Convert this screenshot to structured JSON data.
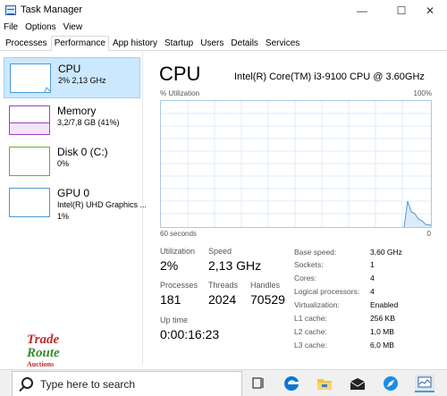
{
  "window": {
    "title": "Task Manager"
  },
  "menu": [
    "File",
    "Options",
    "View"
  ],
  "tabs": [
    "Processes",
    "Performance",
    "App history",
    "Startup",
    "Users",
    "Details",
    "Services"
  ],
  "sidebar": {
    "items": [
      {
        "name": "CPU",
        "detail": "2% 2,13 GHz",
        "detail2": ""
      },
      {
        "name": "Memory",
        "detail": "3,2/7,8 GB (41%)",
        "detail2": ""
      },
      {
        "name": "Disk 0 (C:)",
        "detail": "0%",
        "detail2": ""
      },
      {
        "name": "GPU 0",
        "detail": "Intel(R) UHD Graphics ...",
        "detail2": "1%"
      }
    ]
  },
  "main": {
    "title": "CPU",
    "model": "Intel(R) Core(TM) i3-9100 CPU @ 3.60GHz",
    "util_label": "% Utilization",
    "util_max": "100%",
    "axis_left": "60 seconds",
    "axis_right": "0",
    "stats": {
      "utilization": {
        "label": "Utilization",
        "value": "2%"
      },
      "speed": {
        "label": "Speed",
        "value": "2,13 GHz"
      },
      "processes": {
        "label": "Processes",
        "value": "181"
      },
      "threads": {
        "label": "Threads",
        "value": "2024"
      },
      "handles": {
        "label": "Handles",
        "value": "70529"
      },
      "uptime": {
        "label": "Up time",
        "value": "0:00:16:23"
      }
    },
    "specs": [
      {
        "label": "Base speed:",
        "value": "3,60 GHz"
      },
      {
        "label": "Sockets:",
        "value": "1"
      },
      {
        "label": "Cores:",
        "value": "4"
      },
      {
        "label": "Logical processors:",
        "value": "4"
      },
      {
        "label": "Virtualization:",
        "value": "Enabled"
      },
      {
        "label": "L1 cache:",
        "value": "256 KB"
      },
      {
        "label": "L2 cache:",
        "value": "1,0 MB"
      },
      {
        "label": "L3 cache:",
        "value": "6,0 MB"
      }
    ]
  },
  "watermark": {
    "line1": "Trade",
    "line2": "Route",
    "line3": "Auctions"
  },
  "taskbar": {
    "search_placeholder": "Type here to search",
    "icons": [
      "task-view-icon",
      "edge-icon",
      "file-explorer-icon",
      "mail-icon",
      "safari-icon",
      "task-manager-icon"
    ]
  },
  "colors": {
    "cpu": "#4a9ad6",
    "memory": "#a23ec4",
    "disk": "#6aaa3c",
    "gpu": "#4a9ad6",
    "selected": "#cce8ff"
  }
}
